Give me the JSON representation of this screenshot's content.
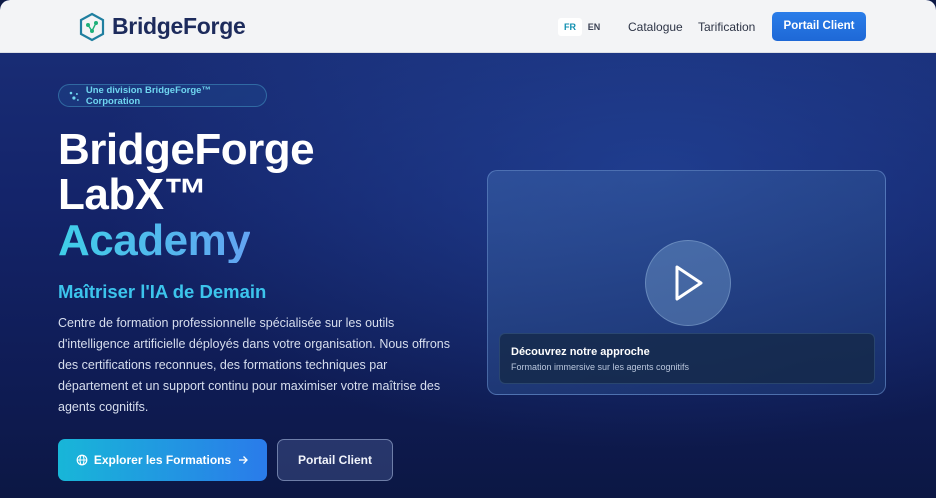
{
  "header": {
    "brand": "BridgeForge",
    "lang_fr": "FR",
    "lang_en": "EN",
    "nav": [
      "Catalogue",
      "Tarification"
    ],
    "cta": "Portail Client"
  },
  "hero": {
    "badge": "Une division BridgeForge™ Corporation",
    "title_line1": "BridgeForge",
    "title_line2": "LabX™",
    "title_line3": "Academy",
    "tagline": "Maîtriser l'IA de Demain",
    "description": "Centre de formation professionnelle spécialisée sur les outils d'intelligence artificielle déployés dans votre organisation. Nous offrons des certifications reconnues, des formations techniques par département et un support continu pour maximiser votre maîtrise des agents cognitifs.",
    "primary_button": "Explorer les Formations",
    "secondary_button": "Portail Client"
  },
  "video": {
    "title": "Découvrez notre approche",
    "subtitle": "Formation immersive sur les agents cognitifs"
  },
  "colors": {
    "accent": "#3cc4ec",
    "header_button": "#2a7de9",
    "brand_text": "#1d2b5c"
  }
}
